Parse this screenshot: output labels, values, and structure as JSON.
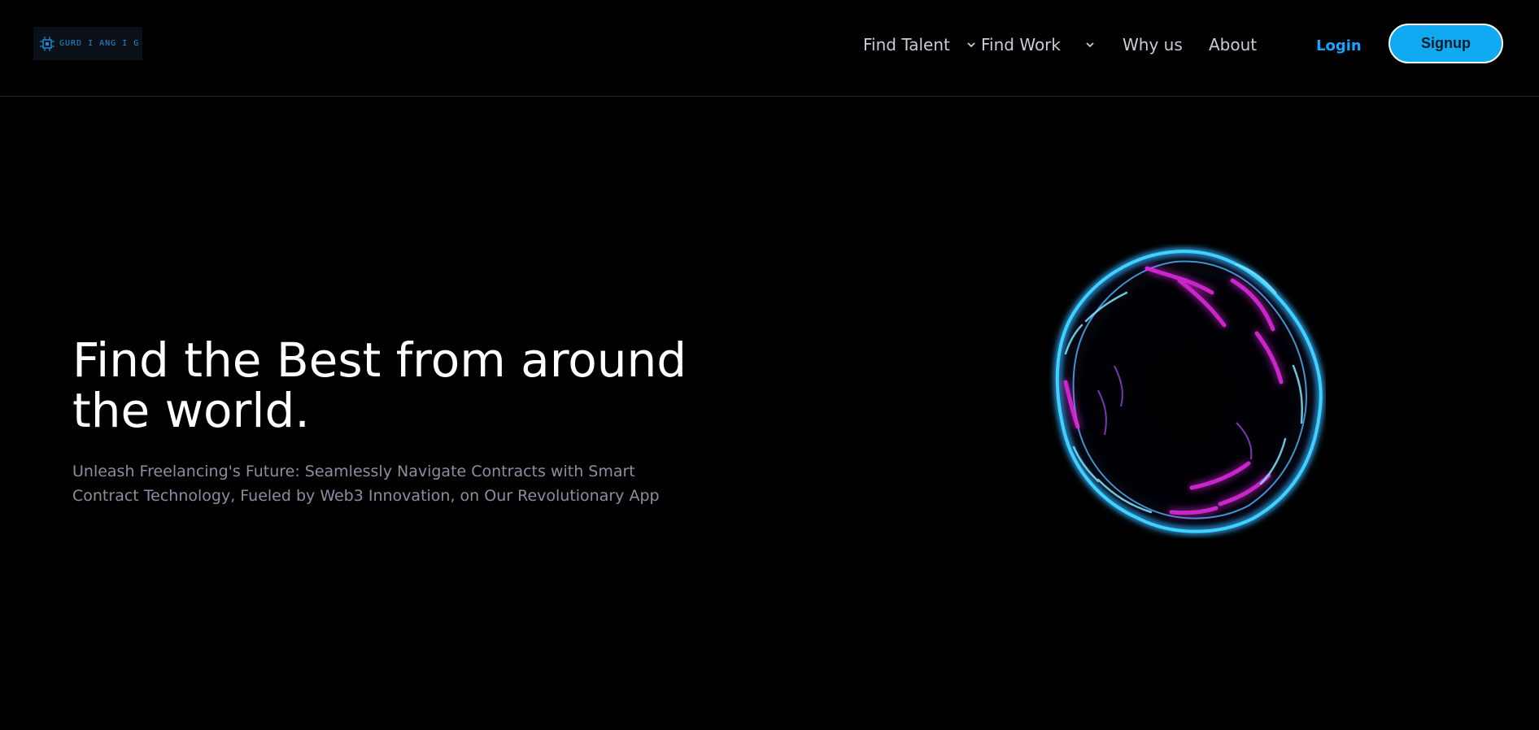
{
  "header": {
    "logo_text": "GURD I ANG I G",
    "logo_icon": "circuit-chip-icon",
    "nav": [
      {
        "label": "Find Talent",
        "has_dropdown": true
      },
      {
        "label": "Find Work",
        "has_dropdown": true
      },
      {
        "label": "Why us",
        "has_dropdown": false
      },
      {
        "label": "About",
        "has_dropdown": false
      }
    ],
    "login_label": "Login",
    "signup_label": "Signup"
  },
  "hero": {
    "title": "Find the Best from around the world.",
    "subtitle": "Unleash Freelancing's Future: Seamlessly Navigate Contracts with Smart Contract Technology, Fueled by Web3 Innovation, on Our Revolutionary App",
    "visual": "glowing-blob-3d-animation"
  },
  "colors": {
    "background": "#000000",
    "accent": "#10aaf2",
    "login_text": "#1aa3ff",
    "nav_text": "#c8ccd4",
    "subtitle_text": "#8a8fa0",
    "blob_cyan": "#3fd2ff",
    "blob_magenta": "#e02be0"
  }
}
